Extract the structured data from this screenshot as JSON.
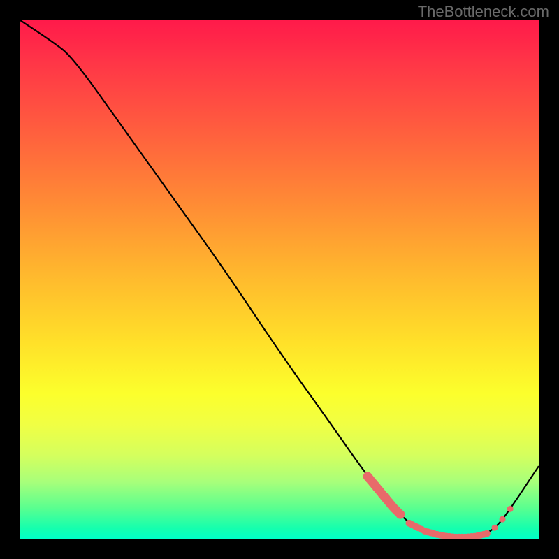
{
  "watermark": "TheBottleneck.com",
  "chart_data": {
    "type": "line",
    "title": "",
    "xlabel": "",
    "ylabel": "",
    "xlim": [
      0,
      100
    ],
    "ylim": [
      0,
      100
    ],
    "series": [
      {
        "name": "curve",
        "x": [
          0,
          6,
          10,
          20,
          30,
          40,
          50,
          60,
          67,
          72,
          75,
          78,
          80,
          82,
          84,
          86,
          88,
          90,
          92,
          94,
          100
        ],
        "values": [
          100,
          96,
          93,
          79,
          65,
          51,
          36,
          22,
          12,
          6,
          3,
          1.5,
          0.9,
          0.5,
          0.3,
          0.3,
          0.5,
          1.0,
          2.5,
          5,
          14
        ]
      }
    ],
    "marker_clusters": [
      {
        "x_start": 67,
        "x_end": 73.5,
        "density": "heavy",
        "y_approx": [
          12,
          6
        ]
      },
      {
        "x_start": 75,
        "x_end": 90,
        "density": "dense_flat",
        "y_approx": [
          3,
          0.3,
          1
        ]
      },
      {
        "x_start": 91.5,
        "x_end": 94.5,
        "density": "sparse",
        "y_approx": [
          2,
          5
        ]
      }
    ],
    "marker_color": "#e86a6a",
    "curve_color": "#000000",
    "gradient_stops": [
      {
        "pos": 0,
        "color": "#ff1a4a"
      },
      {
        "pos": 50,
        "color": "#ffca2c"
      },
      {
        "pos": 80,
        "color": "#e6ff40"
      },
      {
        "pos": 100,
        "color": "#00ffc8"
      }
    ]
  }
}
